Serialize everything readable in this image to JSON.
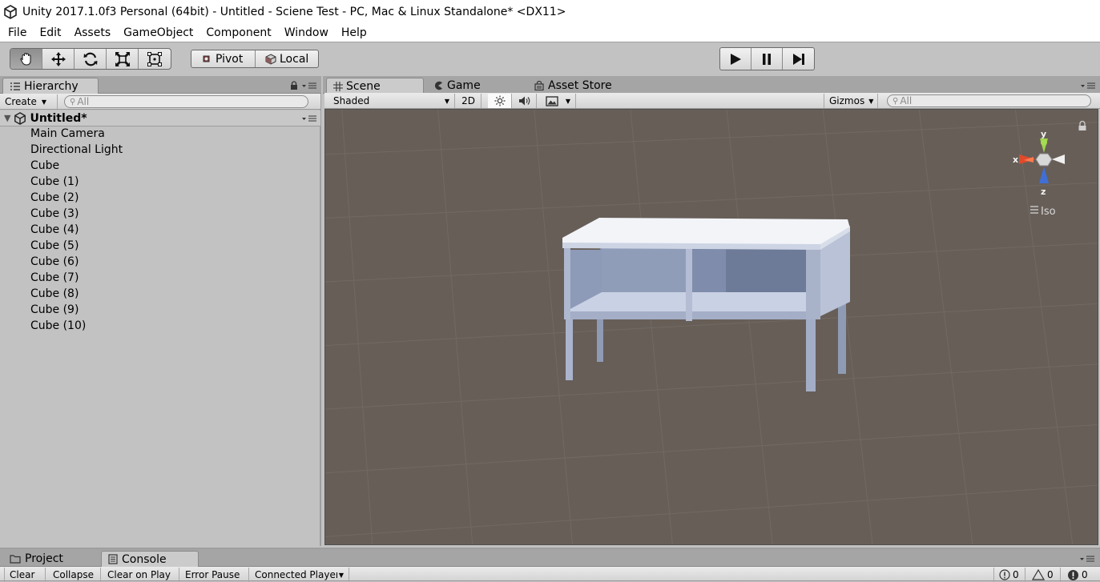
{
  "title": {
    "text": "Unity 2017.1.0f3 Personal (64bit) - Untitled - Sciene Test - PC, Mac & Linux Standalone* <DX11>"
  },
  "menu": {
    "items": [
      "File",
      "Edit",
      "Assets",
      "GameObject",
      "Component",
      "Window",
      "Help"
    ]
  },
  "toolbar": {
    "pivot_label": "Pivot",
    "local_label": "Local"
  },
  "hierarchy": {
    "tab_label": "Hierarchy",
    "create_label": "Create",
    "search_placeholder": "All",
    "scene_name": "Untitled*",
    "items": [
      "Main Camera",
      "Directional Light",
      "Cube",
      "Cube (1)",
      "Cube (2)",
      "Cube (3)",
      "Cube (4)",
      "Cube (5)",
      "Cube (6)",
      "Cube (7)",
      "Cube (8)",
      "Cube (9)",
      "Cube (10)"
    ]
  },
  "scene": {
    "tabs": {
      "scene": "Scene",
      "game": "Game",
      "asset_store": "Asset Store"
    },
    "shading_mode": "Shaded",
    "mode_2d": "2D",
    "gizmos_label": "Gizmos",
    "search_placeholder": "All",
    "gizmo": {
      "x": "x",
      "y": "y",
      "z": "z",
      "projection": "Iso"
    }
  },
  "bottom": {
    "tabs": {
      "project": "Project",
      "console": "Console"
    },
    "console_buttons": [
      "Clear",
      "Collapse",
      "Clear on Play",
      "Error Pause",
      "Connected Player"
    ],
    "counts": {
      "info": "0",
      "warnings": "0",
      "errors": "0"
    }
  }
}
